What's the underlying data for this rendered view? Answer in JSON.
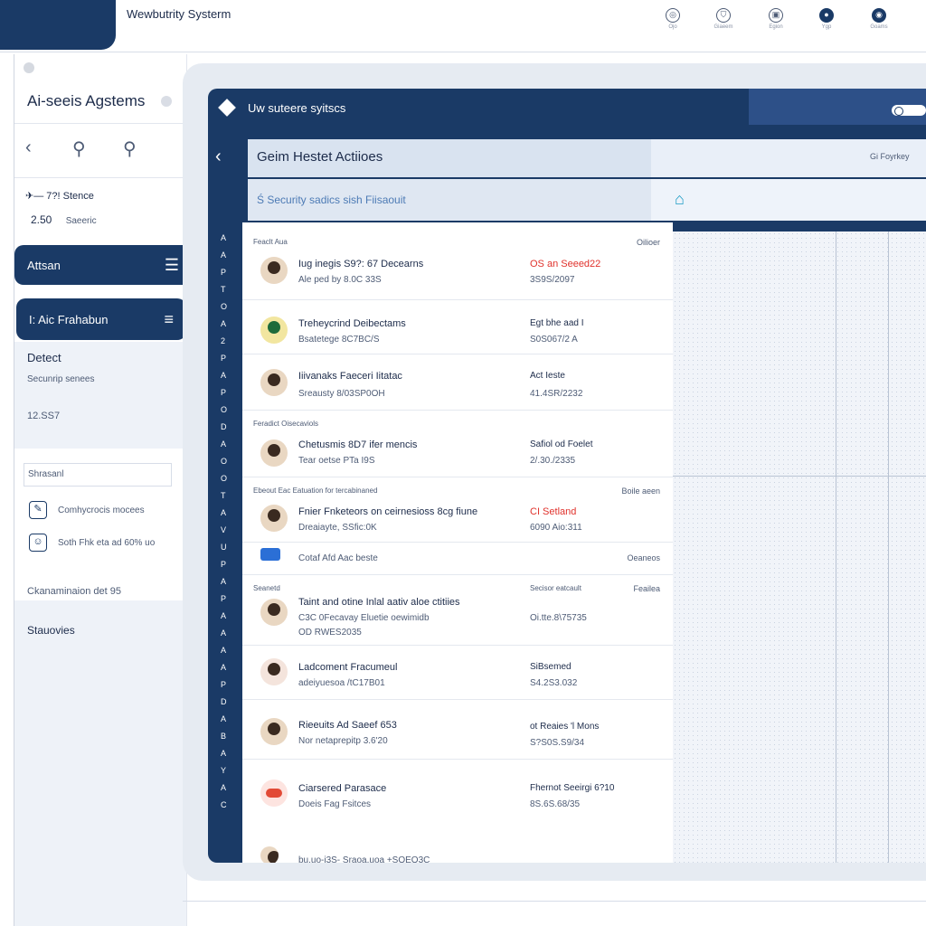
{
  "app": {
    "title": "Wewbutrity Systerm"
  },
  "top_icons": [
    {
      "name": "globe-icon",
      "glyph": "◎",
      "caption": "Ojo"
    },
    {
      "name": "shield-icon",
      "glyph": "⛉",
      "caption": "Giaeem"
    },
    {
      "name": "doc-icon",
      "glyph": "▣",
      "caption": "Egion"
    },
    {
      "name": "user-icon",
      "glyph": "●",
      "caption": "Ygp"
    },
    {
      "name": "profile-icon",
      "glyph": "◉",
      "caption": "Goams"
    }
  ],
  "sidebar": {
    "title": "Ai-seeis Agstems",
    "stat_label": "7?! Stence",
    "stat_value": "2.50",
    "stat_sub": "Saeeric",
    "btn1": {
      "label": "Attsan",
      "icon": "☰"
    },
    "btn2": {
      "label": "I: Aic Frahabun",
      "icon": "≡"
    },
    "detect": {
      "title": "Detect",
      "sub": "Secunrip senees",
      "num": "12.SS7"
    },
    "search_placeholder": "Shrasanl",
    "items": [
      {
        "icon": "✎",
        "label": "Comhycrocis mocees"
      },
      {
        "icon": "☺",
        "label": "Soth Fhk eta ad 60% uo"
      }
    ],
    "footer1": "Ckanaminaion det 95",
    "footer2": "Stauovies"
  },
  "frame": {
    "title": "Uw suteere syitscs",
    "inner_title": "Geim Hestet Actiioes",
    "inner_meta": "Gi Foyrkey",
    "inner_sub": "Ś Security sadics sish Fiisaouit",
    "vertical_text": [
      "A",
      "A",
      "P",
      "T",
      "O",
      "A",
      "2",
      "P",
      "A",
      "P",
      "O",
      "D",
      "A",
      "O",
      "O",
      "T",
      "A",
      "V",
      "U",
      "P",
      "A",
      "P",
      "A",
      "A",
      "A",
      "A",
      "P",
      "D",
      "A",
      "B",
      "A",
      "Y",
      "A",
      "C"
    ]
  },
  "list": {
    "headers": [
      {
        "left": "Feaclt Aua",
        "right": "Oilioer"
      },
      {
        "left": "Feradict Oisecaviols",
        "right": ""
      },
      {
        "left": "Ebeout Eac Eatuation for tercabinaned",
        "right": "Boile aeen"
      },
      {
        "left": "Seanetd",
        "right": "Secisor eatcault"
      }
    ],
    "rows": [
      {
        "title": "Iug inegis S9?: 67 Decearns",
        "sub": "Ale ped by 8.0C 33S",
        "status": "OS an Seeed22",
        "status_alert": true,
        "date": "3S9S/2097",
        "right": ""
      },
      {
        "title": "Treheycrind Deibectams",
        "sub": "Bsatetege 8C7BC/S",
        "status": "Egt bhe aad I",
        "status_alert": false,
        "date": "S0S067/2 A",
        "right": ""
      },
      {
        "title": "Iiivanaks Faeceri Iitatac",
        "sub": "Sreausty 8/03SP0OH",
        "status": "Act Ieste",
        "status_alert": false,
        "date": "41.4SR/2232",
        "right": ""
      },
      {
        "title": "Chetusmis 8D7 ifer mencis",
        "sub": "Tear oetse PTa I9S",
        "status": "Safiol od Foelet",
        "status_alert": false,
        "date": "2/.30./2335",
        "right": ""
      },
      {
        "title": "Fnier Fnketeors on ceirnesioss 8cg fiune",
        "sub": "Dreaiayte, SSfic:0K",
        "status": "CI Setland",
        "status_alert": true,
        "date": "6090 Aio:311",
        "right": ""
      },
      {
        "title": "",
        "sub": "Cotaf Afd Aac beste",
        "status": "",
        "status_alert": false,
        "date": "",
        "right": "Oeaneos"
      },
      {
        "title": "Taint and otine Inlal aativ aloe ctitiies",
        "sub": "C3C 0Fecavay Eluetie oewimidb",
        "sub2": "OD RWES2035",
        "status": "",
        "status_alert": false,
        "date": "Oi.tte.8\\75735",
        "right": "Feailea"
      },
      {
        "title": "Ladcoment Fracumeul",
        "sub": "adeiyuesoa /tC17B01",
        "status": "SiBsemed",
        "status_alert": false,
        "date": "S4.2S3.032",
        "right": ""
      },
      {
        "title": "Rieeuits Ad Saeef 653",
        "sub": "Nor netaprepitp 3.6'20",
        "status": "ot Reaies 'l Mons",
        "status_alert": false,
        "date": "S?S0S.S9/34",
        "right": ""
      },
      {
        "title": "Ciarsered Parasace",
        "sub": "Doeis Fag Fsitces",
        "status": "Fhernot Seeirgi 6?10",
        "status_alert": false,
        "date": "8S.6S.68/35",
        "right": ""
      },
      {
        "title": "",
        "sub": "bu.uo-i3S- Sraoa.uoa +SOEO3C",
        "status": "",
        "status_alert": false,
        "date": "",
        "right": ""
      }
    ]
  }
}
